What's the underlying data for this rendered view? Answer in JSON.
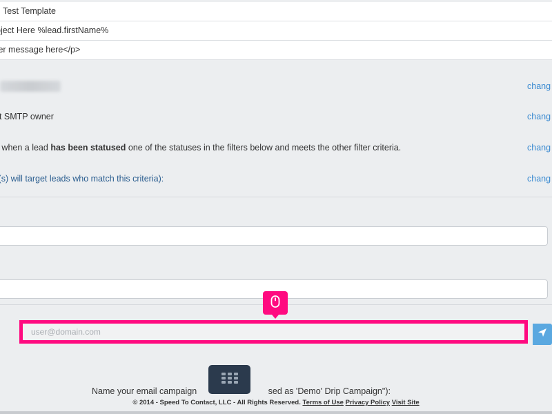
{
  "form_fields": {
    "template_name": "Test Template",
    "subject": "bject Here %lead.firstName%",
    "message": "ter message here</p>"
  },
  "settings": {
    "blurred_value_hidden": true,
    "smtp_owner": "nt SMTP owner",
    "status_rule_prefix": "d when a lead ",
    "status_rule_bold": "has been statused",
    "status_rule_suffix": " one of the statuses in the filters below and meets the other filter criteria.",
    "target_criteria": "il(s) will target leads who match this criteria):",
    "change_label": "chang"
  },
  "email_test": {
    "placeholder": "user@domain.com",
    "value": ""
  },
  "campaign": {
    "name_prompt_left": "Name your email campaign ",
    "name_prompt_right": "sed as 'Demo' Drip Campaign\"):"
  },
  "footer": {
    "copyright": "© 2014 - Speed To Contact, LLC - All Rights Reserved.",
    "terms": "Terms of Use",
    "privacy": "Privacy Policy",
    "visit": "Visit Site"
  },
  "colors": {
    "highlight": "#ff0a80",
    "link": "#3a8ad1",
    "send_button": "#5aa8e0",
    "keypad": "#2b3a4d"
  },
  "icons": [
    "mouse-icon",
    "send-icon",
    "keypad-icon"
  ]
}
